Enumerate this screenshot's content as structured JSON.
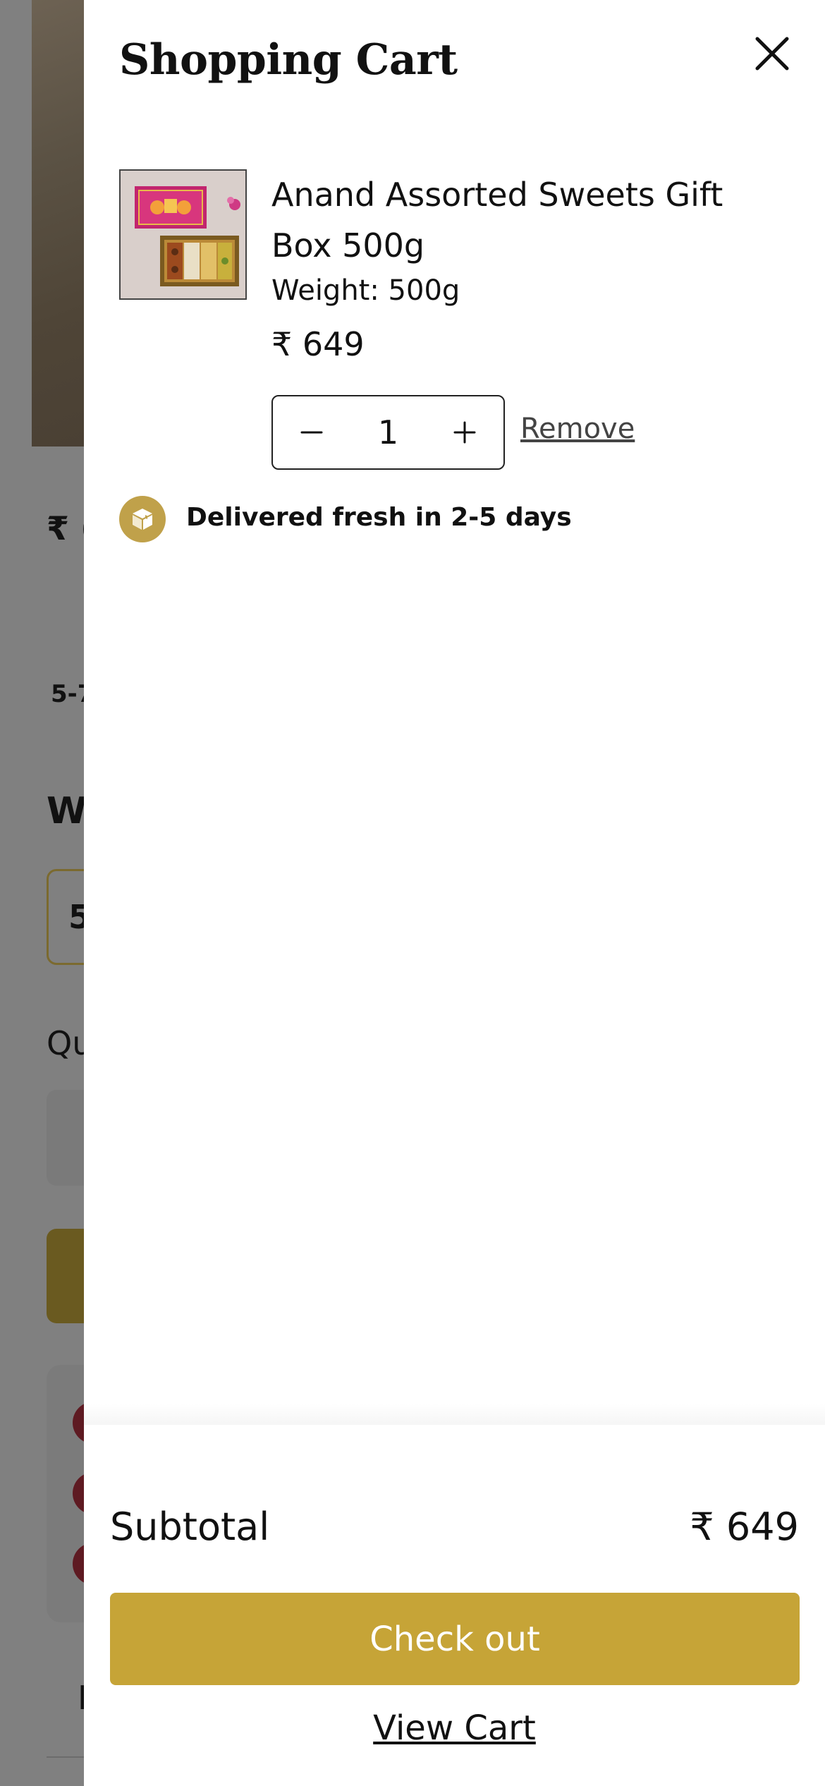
{
  "background": {
    "price_fragment": "₹ (",
    "delivery_fragment": "5-7",
    "heading_fragment": "W",
    "select_fragment": "5",
    "quantity_fragment": "Qu",
    "footer_fragment": "I"
  },
  "drawer": {
    "title": "Shopping Cart",
    "close_icon": "close-icon"
  },
  "cart": {
    "items": [
      {
        "title": "Anand Assorted Sweets Gift Box 500g",
        "weight": "Weight: 500g",
        "price": "₹ 649",
        "quantity": "1",
        "remove_label": "Remove"
      }
    ]
  },
  "delivery": {
    "text": "Delivered fresh in 2-5 days",
    "icon": "box-icon"
  },
  "footer": {
    "subtotal_label": "Subtotal",
    "subtotal_value": "₹ 649",
    "checkout_label": "Check out",
    "view_cart_label": "View Cart"
  },
  "colors": {
    "accent": "#c6a437",
    "badge": "#c0a14a",
    "overlay": "#808080",
    "background_button": "#6a5a20",
    "background_dot": "#5e1a22"
  }
}
